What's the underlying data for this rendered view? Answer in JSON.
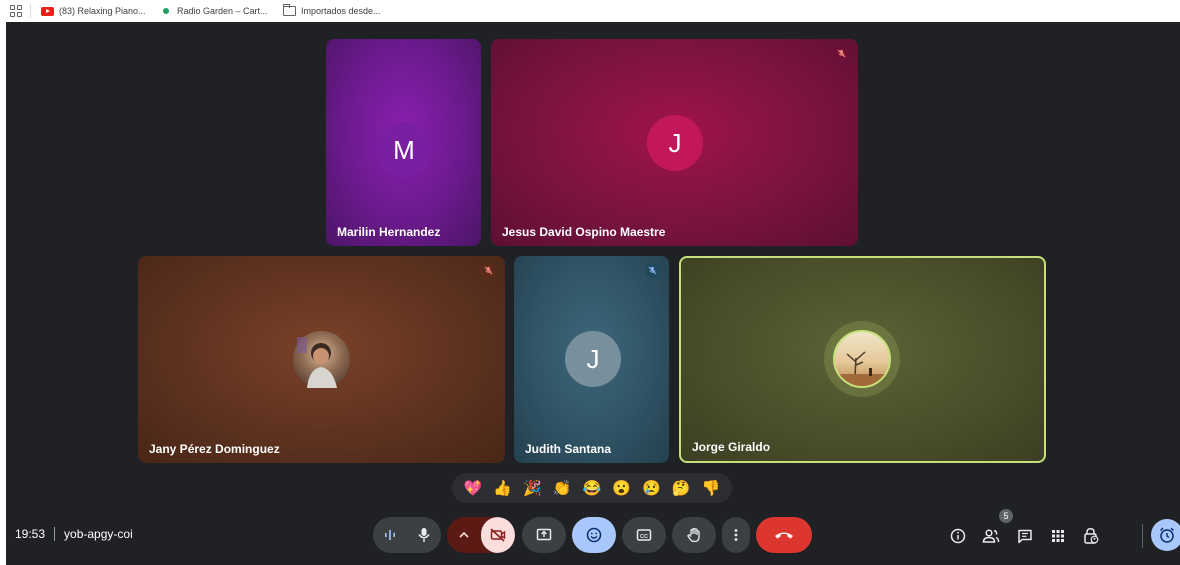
{
  "bookmarks": [
    {
      "label": "(83) Relaxing Piano...",
      "icon": "youtube-icon"
    },
    {
      "label": "Radio Garden – Cart...",
      "icon": "radio-garden-icon"
    },
    {
      "label": "Importados desde...",
      "icon": "folder-icon"
    }
  ],
  "participants": [
    {
      "name": "Marilin Hernandez",
      "initial": "M",
      "avatar_color": "#7b1fa2",
      "muted": false
    },
    {
      "name": "Jesus David Ospino Maestre",
      "initial": "J",
      "avatar_color": "#c2185b",
      "muted": true
    },
    {
      "name": "Jany Pérez Dominguez",
      "initial": "",
      "avatar_color": "",
      "muted": true
    },
    {
      "name": "Judith Santana",
      "initial": "J",
      "avatar_color": "#78909c",
      "muted": true
    },
    {
      "name": "Jorge Giraldo",
      "initial": "",
      "avatar_color": "",
      "muted": false,
      "speaking": true
    }
  ],
  "reactions": [
    "💖",
    "👍",
    "🎉",
    "👏",
    "😂",
    "😮",
    "😢",
    "🤔",
    "👎"
  ],
  "meeting": {
    "time": "19:53",
    "code": "yob-apgy-coi"
  },
  "people_count": "5",
  "colors": {
    "background": "#202124",
    "leave": "#dc362e",
    "active_blue": "#a8c7fa",
    "speaking_border": "#c5e07a"
  }
}
